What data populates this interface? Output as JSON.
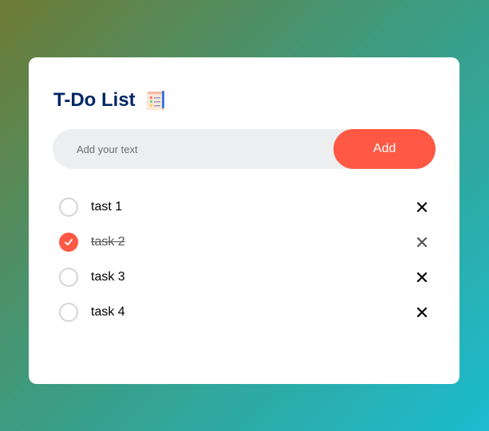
{
  "app": {
    "title": "T-Do List",
    "title_icon": "notepad-icon"
  },
  "input": {
    "placeholder": "Add your text",
    "value": ""
  },
  "add_button": {
    "label": "Add"
  },
  "tasks": [
    {
      "label": "tast 1",
      "done": false
    },
    {
      "label": "task 2",
      "done": true
    },
    {
      "label": "task 3",
      "done": false
    },
    {
      "label": "task 4",
      "done": false
    }
  ],
  "colors": {
    "accent": "#ff5945",
    "title": "#002765",
    "input_bg": "#edeef0"
  }
}
